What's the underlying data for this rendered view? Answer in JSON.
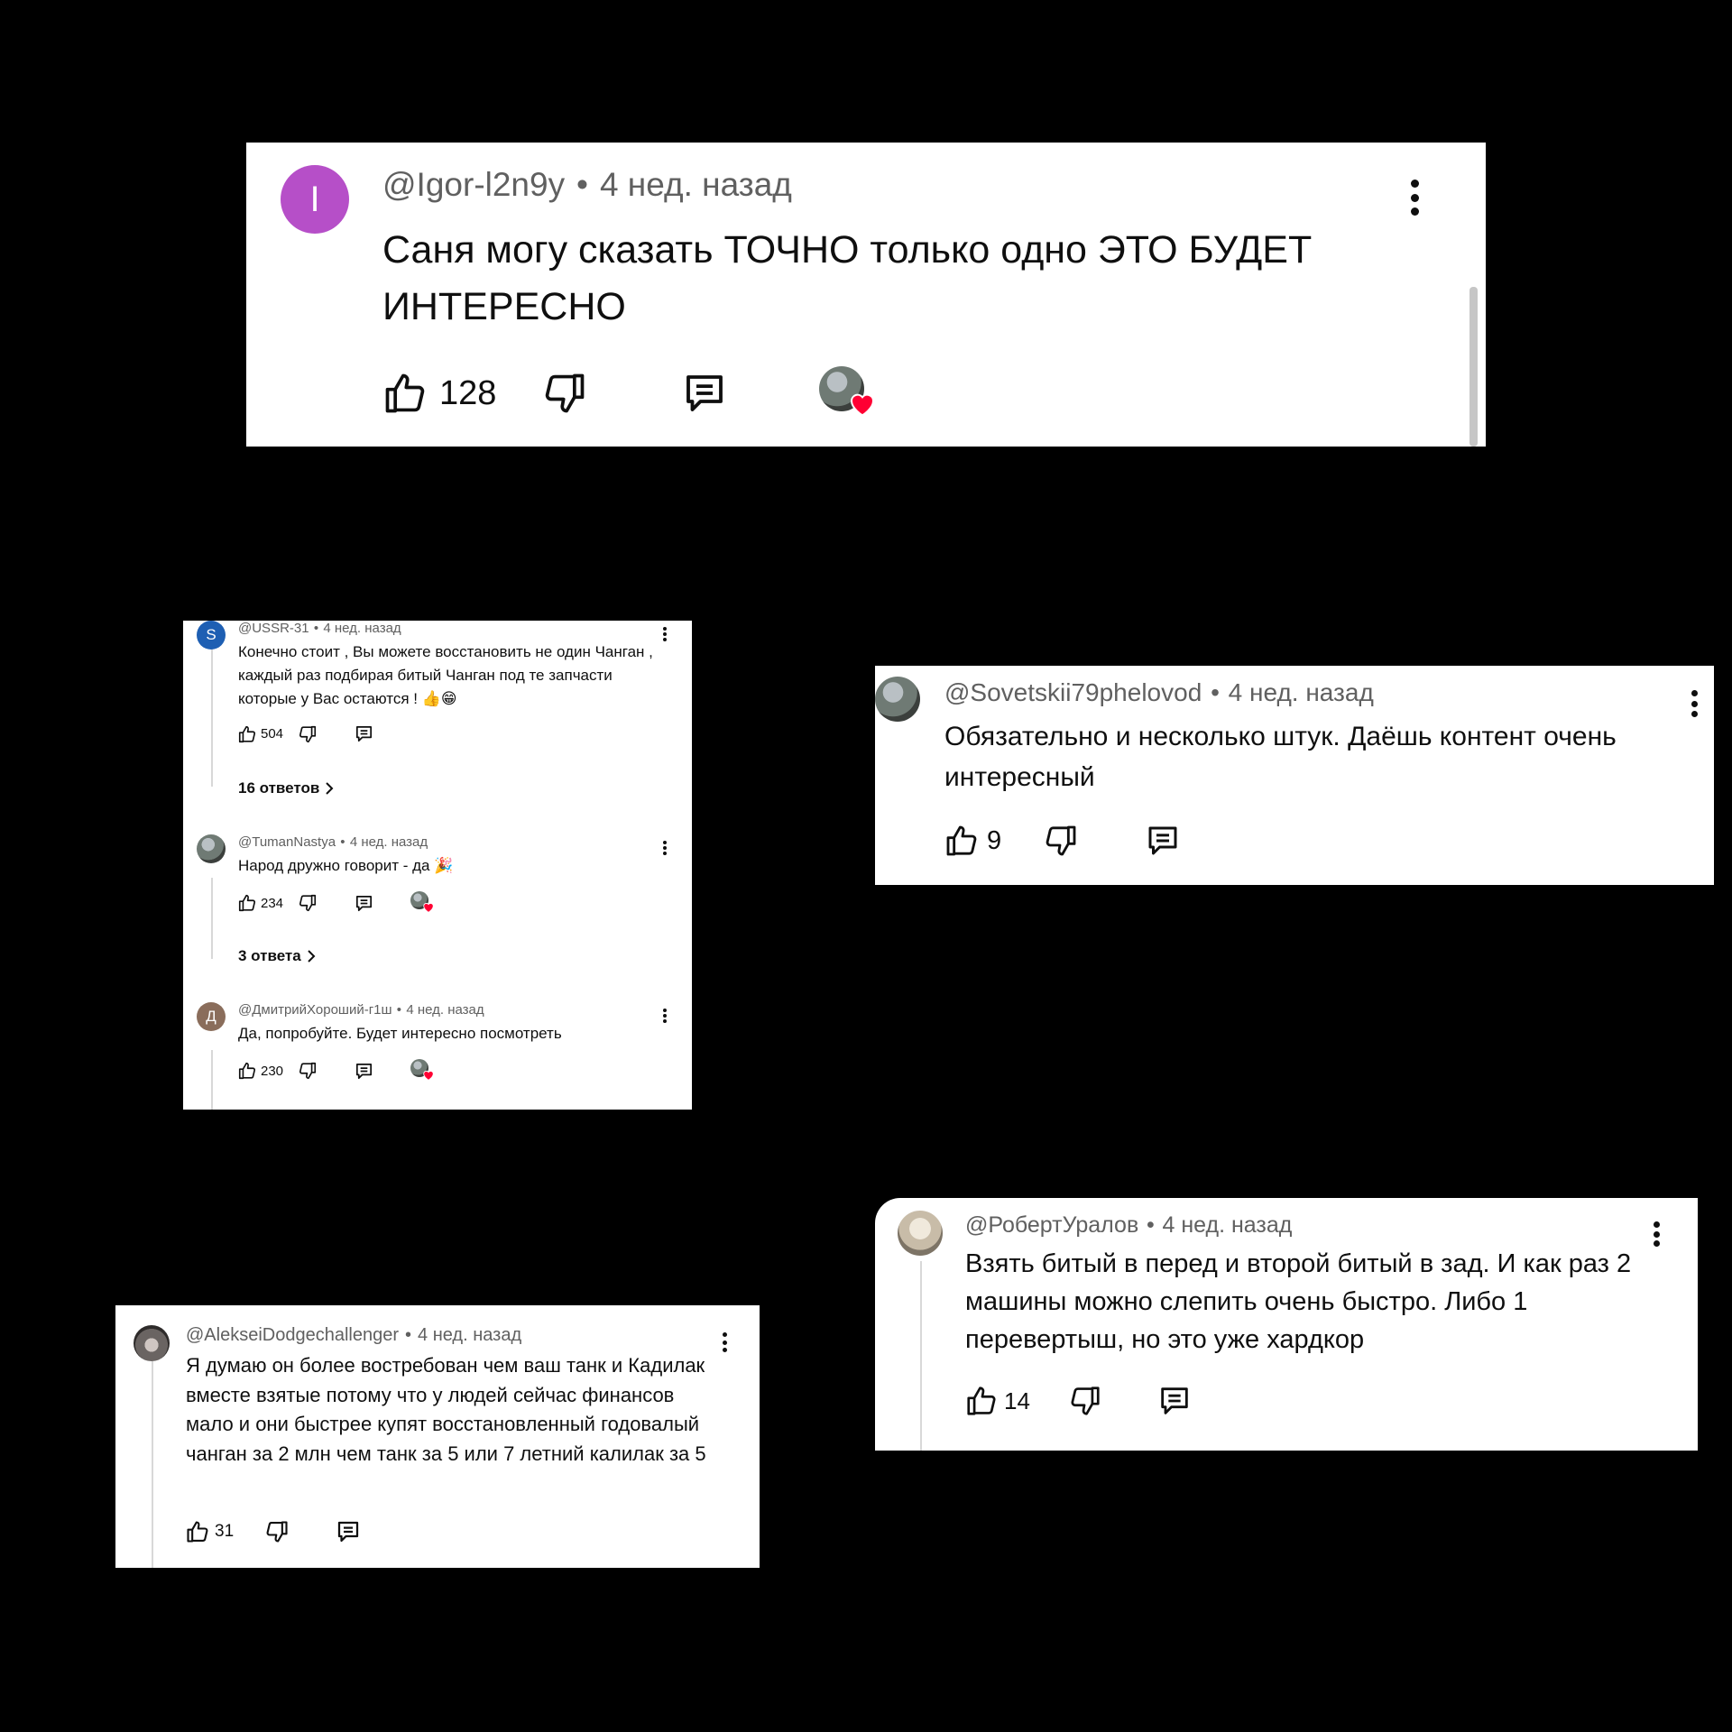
{
  "colors": {
    "accent_heart": "#ff0033",
    "avatar_purple": "#b64fc8",
    "avatar_blue": "#1e5fb3",
    "avatar_brown": "#8a6d5b"
  },
  "icons": [
    "thumb-up-icon",
    "thumb-down-icon",
    "comment-icon",
    "heart-icon",
    "more-vert-icon",
    "chevron-right-icon"
  ],
  "c1": {
    "avatar_letter": "I",
    "user": "@Igor-l2n9y",
    "time": "4 нед. назад",
    "text": "Саня могу сказать ТОЧНО только одно ЭТО БУДЕТ ИНТЕРЕСНО",
    "likes": "128"
  },
  "c2": {
    "items": [
      {
        "avatar_letter": "S",
        "user": "@USSR-31",
        "time": "4 нед. назад",
        "text": "Конечно стоит , Вы можете восстановить не один Чанган , каждый раз подбирая битый Чанган под те запчасти которые у Вас остаются ! 👍😁",
        "likes": "504",
        "replies": "16 ответов"
      },
      {
        "user": "@TumanNastya",
        "time": "4 нед. назад",
        "text": "Народ дружно говорит - да 🎉",
        "likes": "234",
        "replies": "3 ответа"
      },
      {
        "avatar_letter": "Д",
        "user": "@ДмитрийХороший-г1ш",
        "time": "4 нед. назад",
        "text": "Да, попробуйте. Будет интересно посмотреть",
        "likes": "230"
      }
    ]
  },
  "c3": {
    "user": "@Sovetskii79phelovod",
    "time": "4 нед. назад",
    "text": "Обязательно и несколько штук. Даёшь контент очень интересный",
    "likes": "9"
  },
  "c4": {
    "user": "@РобертУралов",
    "time": "4 нед. назад",
    "text": "Взять битый в перед и второй битый в зад. И как раз 2 машины можно слепить очень быстро. Либо 1 перевертыш, но это уже хардкор",
    "likes": "14"
  },
  "c5": {
    "user": "@AlekseiDodgechallenger",
    "time": "4 нед. назад",
    "text": "Я думаю он более востребован чем ваш танк и Кадилак вместе взятые потому что у людей сейчас финансов мало и они быстрее купят восстановленный годовалый  чанган за 2 млн чем танк за 5 или 7 летний калилак за 5",
    "likes": "31"
  }
}
